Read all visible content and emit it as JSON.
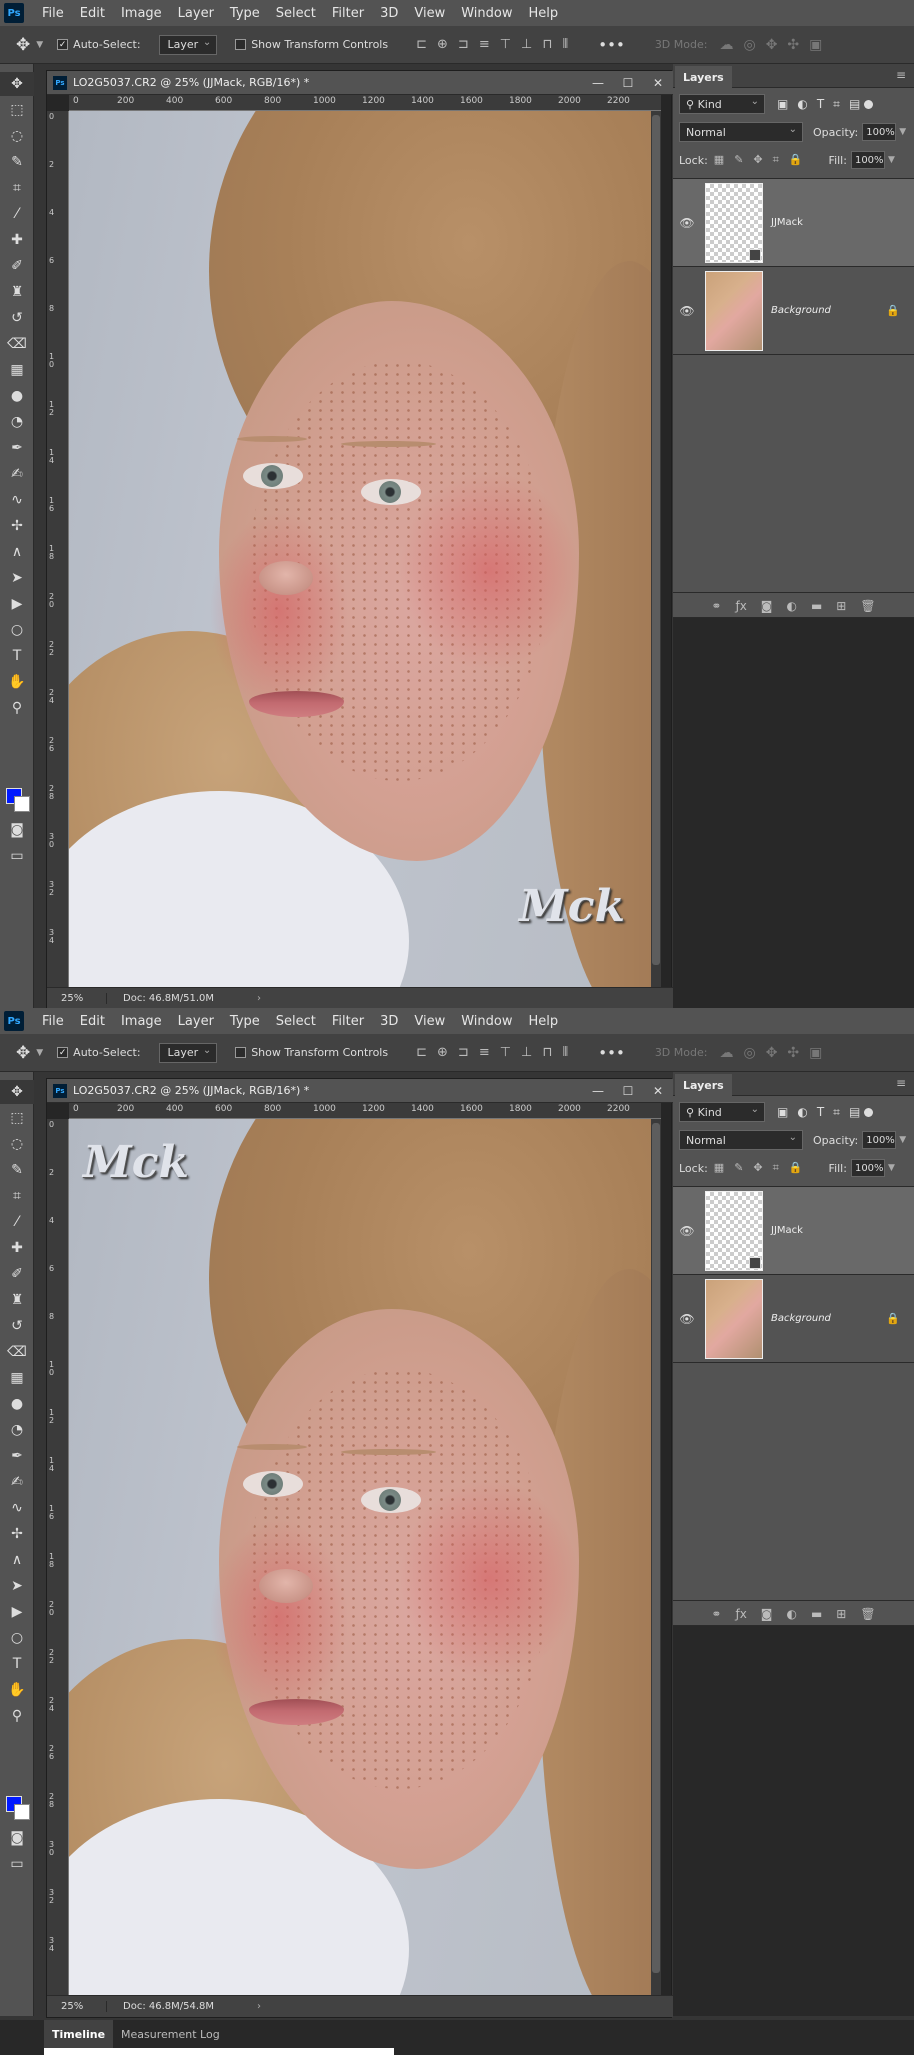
{
  "app": {
    "logo": "Ps"
  },
  "menu": [
    "File",
    "Edit",
    "Image",
    "Layer",
    "Type",
    "Select",
    "Filter",
    "3D",
    "View",
    "Window",
    "Help"
  ],
  "options": {
    "auto_select_label": "Auto-Select:",
    "auto_select_checked": "✓",
    "layer_select": "Layer",
    "show_transform_label": "Show Transform Controls",
    "more": "•••",
    "mode_3d": "3D Mode:"
  },
  "document": {
    "title": "LO2G5037.CR2 @ 25% (JJMack, RGB/16*) *",
    "ruler_h": [
      "0",
      "200",
      "400",
      "600",
      "800",
      "1000",
      "1200",
      "1400",
      "1600",
      "1800",
      "2000",
      "2200"
    ],
    "ruler_v": [
      "0",
      "2",
      "4",
      "6",
      "8",
      "10",
      "12",
      "14",
      "16",
      "18",
      "20",
      "22",
      "24",
      "26",
      "28",
      "30",
      "32",
      "34"
    ],
    "zoom": "25%",
    "docsize_1": "Doc: 46.8M/51.0M",
    "docsize_2": "Doc: 46.8M/54.8M",
    "status_arrow": "›"
  },
  "watermark": {
    "text": "Mck"
  },
  "layers_panel": {
    "tab": "Layers",
    "kind": "Kind",
    "blend_mode": "Normal",
    "opacity_label": "Opacity:",
    "opacity": "100%",
    "lock_label": "Lock:",
    "fill_label": "Fill:",
    "fill": "100%",
    "layers": [
      {
        "name": "JJMack",
        "type": "smart-object",
        "visible": true,
        "selected": true
      },
      {
        "name": "Background",
        "type": "image",
        "visible": true,
        "locked": true
      }
    ]
  },
  "bottom_tabs": [
    "Timeline",
    "Measurement Log"
  ],
  "colors": {
    "foreground": "#0019ff",
    "background": "#ffffff",
    "accent": "#31a8ff"
  }
}
